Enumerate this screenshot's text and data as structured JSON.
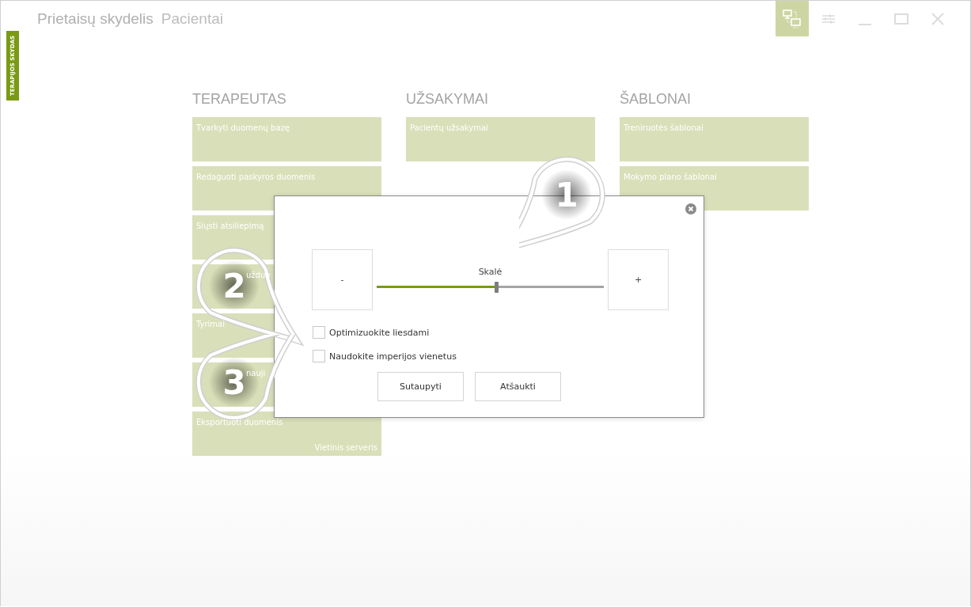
{
  "window": {
    "title": "Prietaisų skydelis",
    "subtitle": "Pacientai"
  },
  "side_tab": {
    "label": "TERAPIJOS SKYDAS"
  },
  "title_buttons": [
    {
      "kind": "network",
      "selected": true
    },
    {
      "kind": "menu",
      "selected": false
    },
    {
      "kind": "minimize",
      "selected": false
    },
    {
      "kind": "maximize",
      "selected": false
    },
    {
      "kind": "close",
      "selected": false
    }
  ],
  "columns": [
    {
      "title": "TERAPEUTAS",
      "tiles": [
        {
          "label": "Tvarkyti duomenų bazę"
        },
        {
          "label": "Redaguoti paskyros duomenis"
        },
        {
          "label": "Siųsti atsiliepimą"
        },
        {
          "label": "užduo",
          "kind": "covered"
        },
        {
          "label": "Tyrimai"
        },
        {
          "label": "nauji",
          "kind": "covered"
        },
        {
          "label": "Eksportuoti duomenis",
          "footer": "Vietinis serveris"
        }
      ]
    },
    {
      "title": "UŽSAKYMAI",
      "tiles": [
        {
          "label": "Pacientų užsakymai"
        }
      ]
    },
    {
      "title": "ŠABLONAI",
      "tiles": [
        {
          "label": "Treniruotės šablonai"
        },
        {
          "label": "Mokymo plano šablonai"
        }
      ]
    }
  ],
  "dialog": {
    "minus": "-",
    "plus": "+",
    "slider": {
      "label": "Skalė",
      "level": 0.53
    },
    "options": [
      {
        "label": "Optimizuokite liesdami",
        "checked": false
      },
      {
        "label": "Naudokite imperijos vienetus",
        "checked": false
      }
    ],
    "buttons": [
      "Sutaupyti",
      "Atšaukti"
    ]
  },
  "callouts": [
    {
      "number": "1"
    },
    {
      "number": "2"
    },
    {
      "number": "3"
    }
  ]
}
